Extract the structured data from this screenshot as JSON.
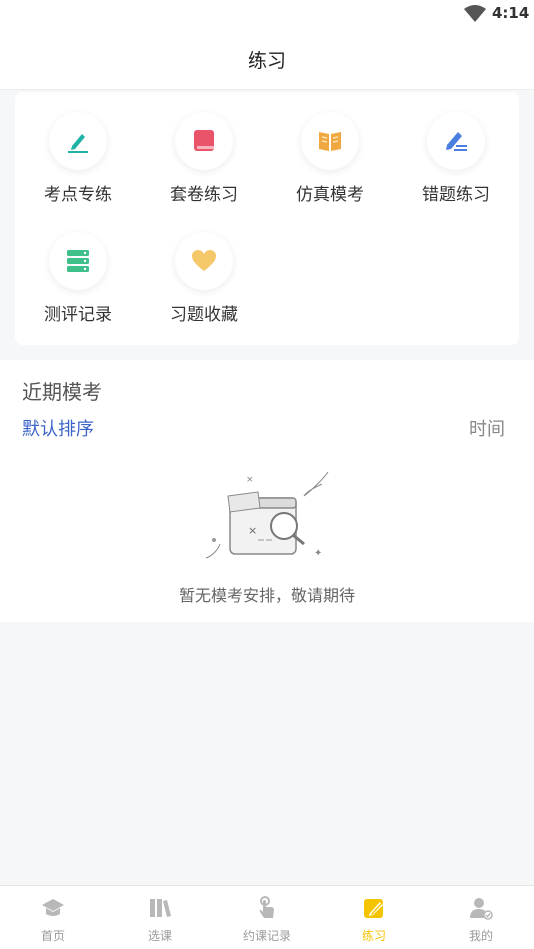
{
  "status_bar": {
    "time": "4:14"
  },
  "header": {
    "title": "练习"
  },
  "practice_menu": [
    {
      "label": "考点专练",
      "icon": "pen-underline-icon"
    },
    {
      "label": "套卷练习",
      "icon": "book-icon"
    },
    {
      "label": "仿真模考",
      "icon": "open-book-icon"
    },
    {
      "label": "错题练习",
      "icon": "edit-lines-icon"
    },
    {
      "label": "测评记录",
      "icon": "list-stack-icon"
    },
    {
      "label": "习题收藏",
      "icon": "heart-icon"
    }
  ],
  "recent": {
    "title": "近期模考",
    "sort_default": "默认排序",
    "sort_time": "时间",
    "empty_text": "暂无模考安排，敬请期待"
  },
  "tabs": [
    {
      "label": "首页",
      "icon": "graduation-cap-icon",
      "active": false
    },
    {
      "label": "选课",
      "icon": "books-icon",
      "active": false
    },
    {
      "label": "约课记录",
      "icon": "hand-pointer-icon",
      "active": false
    },
    {
      "label": "练习",
      "icon": "pencil-square-icon",
      "active": true
    },
    {
      "label": "我的",
      "icon": "user-icon",
      "active": false
    }
  ],
  "colors": {
    "accent_yellow": "#f5c400",
    "link_blue": "#3c64c8",
    "icon_teal": "#1fb2a6",
    "icon_red": "#e9546b",
    "icon_orange": "#f0a940",
    "icon_blue": "#4a7fe0",
    "icon_green": "#3fbf8a",
    "icon_gold": "#f5c86a"
  }
}
